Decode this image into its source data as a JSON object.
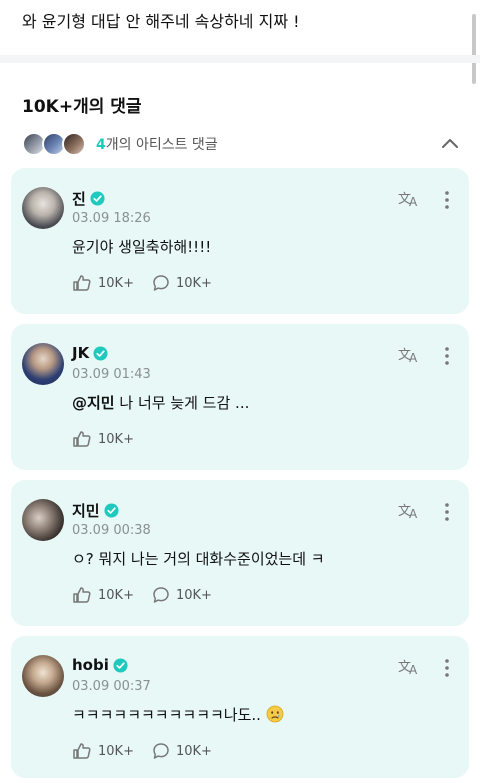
{
  "post": {
    "text": "와 윤기형 대답 안 해주네 속상하네 지짜 !"
  },
  "comments_section": {
    "title": "10K+개의 댓글",
    "artist_count": "4",
    "artist_label": "개의 아티스트 댓글"
  },
  "colors": {
    "accent": "#1fc9bd",
    "card_bg": "#e7f8f6",
    "muted": "#8a8f94"
  },
  "comments": [
    {
      "name": "진",
      "time": "03.09 18:26",
      "text": "윤기야 생일축하해!!!!",
      "likes": "10K+",
      "replies": "10K+"
    },
    {
      "name": "JK",
      "time": "03.09 01:43",
      "mention": "@지민",
      "text": " 나 너무 늦게 드감 ...",
      "likes": "10K+"
    },
    {
      "name": "지민",
      "time": "03.09 00:38",
      "text": "ㅇ?  뭐지 나는 거의 대화수준이었는데 ㅋ",
      "likes": "10K+",
      "replies": "10K+"
    },
    {
      "name": "hobi",
      "time": "03.09 00:37",
      "text": "ㅋㅋㅋㅋㅋㅋㅋㅋㅋㅋㅋ나도..",
      "likes": "10K+",
      "replies": "10K+"
    }
  ],
  "icons": {
    "verified": "verified-badge-icon",
    "translate": "translate-icon",
    "more": "more-vertical-icon",
    "like": "like-icon",
    "reply": "reply-bubble-icon",
    "chevron": "chevron-up-icon",
    "emoji": "crying-face-emoji"
  }
}
